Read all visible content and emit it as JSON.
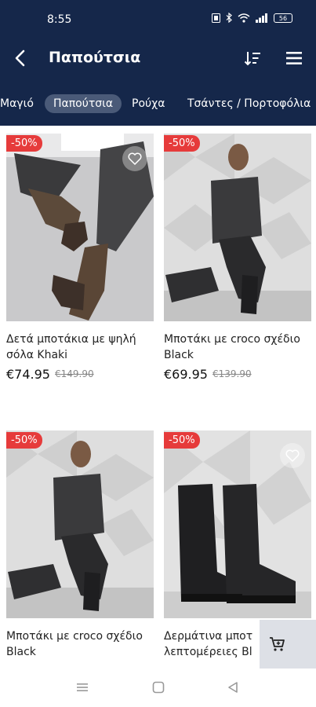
{
  "status": {
    "time": "8:55",
    "battery": "56"
  },
  "header": {
    "title": "Παπούτσια"
  },
  "tabs": [
    {
      "label": "Μαγιό"
    },
    {
      "label": "Παπούτσια",
      "active": true
    },
    {
      "label": "Ρούχα"
    },
    {
      "label": "Τσάντες / Πορτοφόλια"
    }
  ],
  "products": [
    {
      "badge": "-50%",
      "name": "Δετά μποτάκια με ψηλή σόλα Khaki",
      "price": "€74.95",
      "old_price": "€149.90"
    },
    {
      "badge": "-50%",
      "name": "Μποτάκι με croco σχέδιο Black",
      "price": "€69.95",
      "old_price": "€139.90"
    },
    {
      "badge": "-50%",
      "name": "Μποτάκι με croco σχέδιο Black"
    },
    {
      "badge": "-50%",
      "name": "Δερμάτινα μποτ λεπτομέρειες Bl"
    }
  ],
  "colors": {
    "header_bg": "#15274a",
    "badge": "#e63b3b",
    "active_tab": "#4a5a78"
  }
}
